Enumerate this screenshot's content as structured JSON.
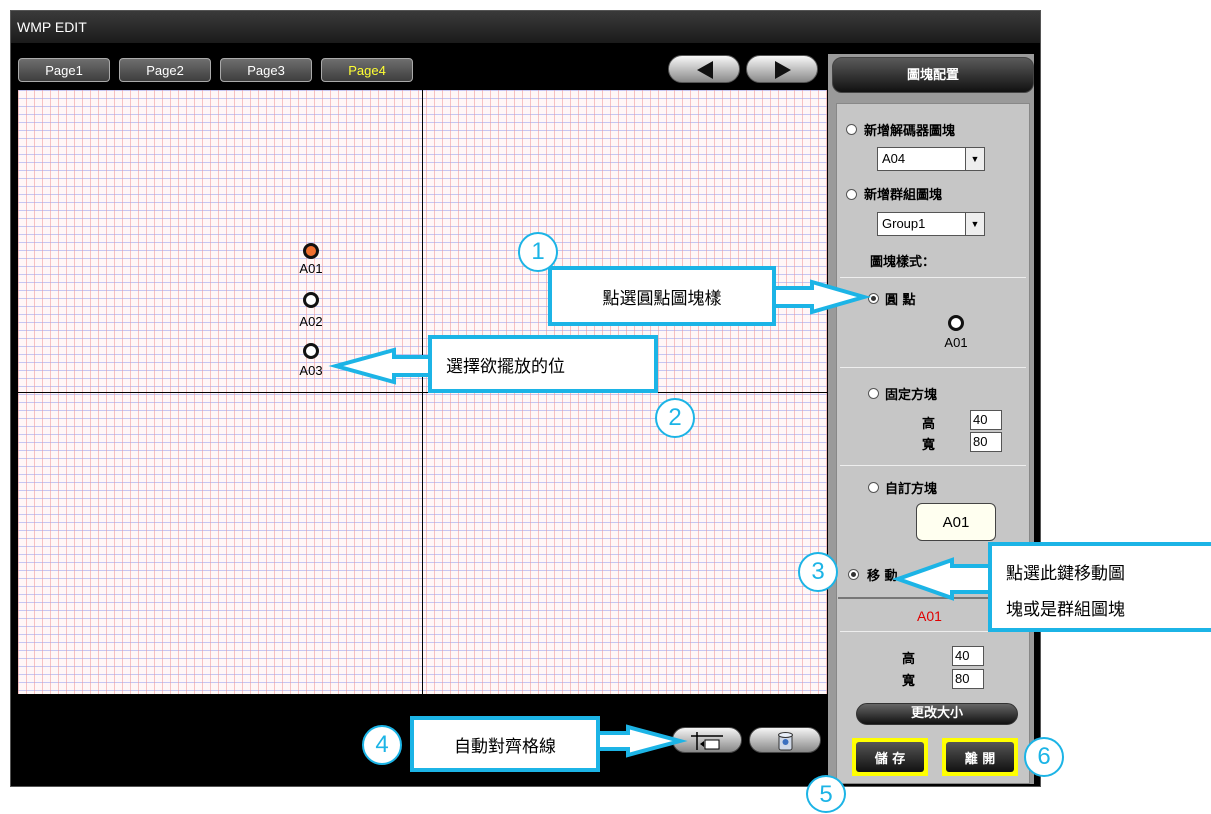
{
  "window": {
    "title": "WMP EDIT"
  },
  "tabs": [
    {
      "label": "Page1"
    },
    {
      "label": "Page2"
    },
    {
      "label": "Page3"
    },
    {
      "label": "Page4",
      "active": true
    }
  ],
  "nav": {
    "prev_icon": "left-arrow-icon",
    "next_icon": "right-arrow-icon"
  },
  "canvas": {
    "nodes": [
      {
        "label": "A01",
        "selected": true
      },
      {
        "label": "A02"
      },
      {
        "label": "A03"
      }
    ]
  },
  "panel": {
    "header": "圖塊配置",
    "add_decoder_label": "新增解碼器圖塊",
    "decoder_value": "A04",
    "add_group_label": "新增群組圖塊",
    "group_value": "Group1",
    "style_label": "圖塊樣式：",
    "dot_label": "圓 點",
    "dot_preview_label": "A01",
    "fixed_block_label": "固定方塊",
    "height_label": "高",
    "width_label": "寬",
    "fixed_height": "40",
    "fixed_width": "80",
    "custom_block_label": "自訂方塊",
    "custom_preview_label": "A01",
    "move_label": "移 動",
    "move_target": "A01",
    "move_height_label": "高",
    "move_width_label": "寬",
    "move_height": "40",
    "move_width": "80",
    "resize_label": "更改大小",
    "save_label": "儲 存",
    "exit_label": "離 開"
  },
  "callouts": {
    "c1": "點選圓點圖塊樣",
    "c2": "選擇欲擺放的位",
    "c3_line1": "點選此鍵移動圖",
    "c3_line2": "塊或是群組圖塊",
    "c4": "自動對齊格線"
  },
  "markers": [
    "1",
    "2",
    "3",
    "4",
    "5",
    "6"
  ],
  "colors": {
    "accent": "#1cb4e6",
    "highlight": "#ffff00",
    "active_tab": "#ffff33",
    "selected_node": "#f07030"
  }
}
